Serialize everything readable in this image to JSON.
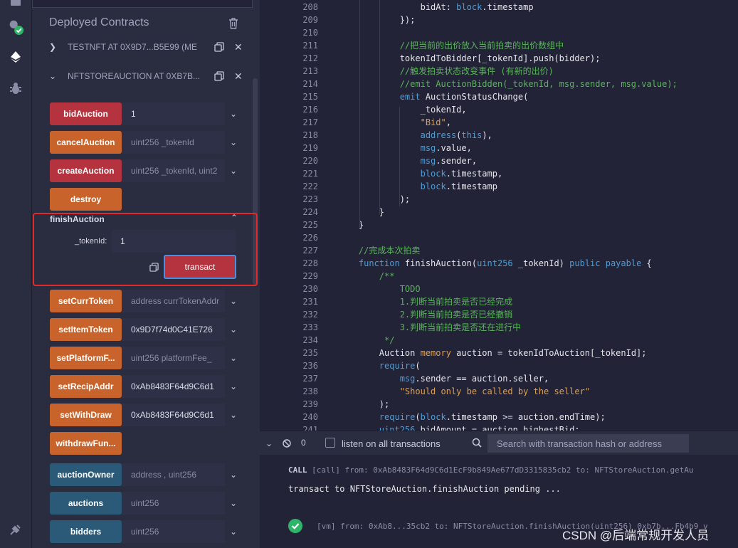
{
  "sidebar_panel": {
    "title": "Deployed Contracts",
    "contracts": [
      {
        "name": "TESTNFT AT 0X9D7...B5E99 (ME",
        "expanded": false
      },
      {
        "name": "NFTSTOREAUCTION AT 0XB7B...",
        "expanded": true
      }
    ],
    "functions": [
      {
        "label": "bidAuction",
        "color": "red",
        "value": "1",
        "placeholder": ""
      },
      {
        "label": "cancelAuction",
        "color": "orange",
        "value": "",
        "placeholder": "uint256 _tokenId"
      },
      {
        "label": "createAuction",
        "color": "red",
        "value": "",
        "placeholder": "uint256 _tokenId, uint2"
      },
      {
        "label": "destroy",
        "color": "orange",
        "value": "",
        "placeholder": ""
      },
      {
        "label": "setCurrToken",
        "color": "orange",
        "value": "",
        "placeholder": "address currTokenAddr"
      },
      {
        "label": "setItemToken",
        "color": "orange",
        "value": "0x9D7f74d0C41E726",
        "placeholder": ""
      },
      {
        "label": "setPlatformF...",
        "color": "orange",
        "value": "",
        "placeholder": "uint256 platformFee_"
      },
      {
        "label": "setRecipAddr",
        "color": "orange",
        "value": "0xAb8483F64d9C6d1",
        "placeholder": ""
      },
      {
        "label": "setWithDraw",
        "color": "orange",
        "value": "0xAb8483F64d9C6d1",
        "placeholder": ""
      },
      {
        "label": "withdrawFun...",
        "color": "orange",
        "value": "",
        "placeholder": ""
      },
      {
        "label": "auctionOwner",
        "color": "blue",
        "value": "",
        "placeholder": "address , uint256"
      },
      {
        "label": "auctions",
        "color": "blue",
        "value": "",
        "placeholder": "uint256"
      },
      {
        "label": "bidders",
        "color": "blue",
        "value": "",
        "placeholder": "uint256"
      }
    ],
    "expanded_function": {
      "title": "finishAuction",
      "param_label": "_tokenId:",
      "param_value": "1",
      "transact_label": "transact"
    }
  },
  "editor": {
    "lines": [
      {
        "n": "208",
        "i": 0,
        "segs": [
          [
            "                bidAt: ",
            ""
          ],
          [
            "block",
            "kw"
          ],
          [
            ".timestamp",
            ""
          ]
        ]
      },
      {
        "n": "209",
        "i": 0,
        "segs": [
          [
            "            });",
            ""
          ]
        ]
      },
      {
        "n": "210",
        "i": 0,
        "segs": [
          [
            "",
            ""
          ]
        ]
      },
      {
        "n": "211",
        "i": 0,
        "segs": [
          [
            "            ",
            ""
          ],
          [
            "//把当前的出价放入当前拍卖的出价数组中",
            "cm"
          ]
        ]
      },
      {
        "n": "212",
        "i": 0,
        "segs": [
          [
            "            tokenIdToBidder[_tokenId].push(bidder);",
            ""
          ]
        ]
      },
      {
        "n": "213",
        "i": 0,
        "segs": [
          [
            "            ",
            ""
          ],
          [
            "//触发拍卖状态改变事件 (有新的出价)",
            "cm"
          ]
        ]
      },
      {
        "n": "214",
        "i": 0,
        "segs": [
          [
            "            ",
            ""
          ],
          [
            "//emit AuctionBidden(_tokenId, msg.sender, msg.value);",
            "cm"
          ]
        ]
      },
      {
        "n": "215",
        "i": 0,
        "segs": [
          [
            "            ",
            ""
          ],
          [
            "emit",
            "kw"
          ],
          [
            " AuctionStatusChange(",
            ""
          ]
        ]
      },
      {
        "n": "216",
        "i": 0,
        "segs": [
          [
            "                _tokenId,",
            ""
          ]
        ]
      },
      {
        "n": "217",
        "i": 0,
        "segs": [
          [
            "                ",
            ""
          ],
          [
            "\"Bid\"",
            "str"
          ],
          [
            ",",
            ""
          ]
        ]
      },
      {
        "n": "218",
        "i": 0,
        "segs": [
          [
            "                ",
            ""
          ],
          [
            "address",
            "kw"
          ],
          [
            "(",
            ""
          ],
          [
            "this",
            "kw"
          ],
          [
            "),",
            ""
          ]
        ]
      },
      {
        "n": "219",
        "i": 0,
        "segs": [
          [
            "                ",
            ""
          ],
          [
            "msg",
            "kw"
          ],
          [
            ".value,",
            ""
          ]
        ]
      },
      {
        "n": "220",
        "i": 0,
        "segs": [
          [
            "                ",
            ""
          ],
          [
            "msg",
            "kw"
          ],
          [
            ".sender,",
            ""
          ]
        ]
      },
      {
        "n": "221",
        "i": 0,
        "segs": [
          [
            "                ",
            ""
          ],
          [
            "block",
            "kw"
          ],
          [
            ".timestamp,",
            ""
          ]
        ]
      },
      {
        "n": "222",
        "i": 0,
        "segs": [
          [
            "                ",
            ""
          ],
          [
            "block",
            "kw"
          ],
          [
            ".timestamp",
            ""
          ]
        ]
      },
      {
        "n": "223",
        "i": 0,
        "segs": [
          [
            "            );",
            ""
          ]
        ]
      },
      {
        "n": "224",
        "i": 0,
        "segs": [
          [
            "        }",
            ""
          ]
        ]
      },
      {
        "n": "225",
        "i": 0,
        "segs": [
          [
            "    }",
            ""
          ]
        ]
      },
      {
        "n": "226",
        "i": 0,
        "segs": [
          [
            "",
            ""
          ]
        ]
      },
      {
        "n": "227",
        "i": 0,
        "segs": [
          [
            "    ",
            ""
          ],
          [
            "//完成本次拍卖",
            "cm"
          ]
        ]
      },
      {
        "n": "228",
        "i": 0,
        "segs": [
          [
            "    ",
            ""
          ],
          [
            "function",
            "kw"
          ],
          [
            " finishAuction(",
            ""
          ],
          [
            "uint256",
            "kw"
          ],
          [
            " _tokenId) ",
            ""
          ],
          [
            "public",
            "kw"
          ],
          [
            " ",
            ""
          ],
          [
            "payable",
            "kw"
          ],
          [
            " {",
            ""
          ]
        ]
      },
      {
        "n": "229",
        "i": 0,
        "segs": [
          [
            "        ",
            ""
          ],
          [
            "/**",
            "cm"
          ]
        ]
      },
      {
        "n": "230",
        "i": 0,
        "segs": [
          [
            "            ",
            ""
          ],
          [
            "TODO",
            "cm"
          ]
        ]
      },
      {
        "n": "231",
        "i": 0,
        "segs": [
          [
            "            ",
            ""
          ],
          [
            "1.判断当前拍卖是否已经完成",
            "cm"
          ]
        ]
      },
      {
        "n": "232",
        "i": 0,
        "segs": [
          [
            "            ",
            ""
          ],
          [
            "2.判断当前拍卖是否已经撤销",
            "cm"
          ]
        ]
      },
      {
        "n": "233",
        "i": 0,
        "segs": [
          [
            "            ",
            ""
          ],
          [
            "3.判断当前拍卖是否还在进行中",
            "cm"
          ]
        ]
      },
      {
        "n": "234",
        "i": 0,
        "segs": [
          [
            "         ",
            ""
          ],
          [
            "*/",
            "cm"
          ]
        ]
      },
      {
        "n": "235",
        "i": 0,
        "segs": [
          [
            "        Auction ",
            ""
          ],
          [
            "memory",
            "str"
          ],
          [
            " auction = tokenIdToAuction[_tokenId];",
            ""
          ]
        ]
      },
      {
        "n": "236",
        "i": 0,
        "segs": [
          [
            "        ",
            ""
          ],
          [
            "require",
            "kw"
          ],
          [
            "(",
            ""
          ]
        ]
      },
      {
        "n": "237",
        "i": 0,
        "segs": [
          [
            "            ",
            ""
          ],
          [
            "msg",
            "kw"
          ],
          [
            ".sender == auction.seller,",
            ""
          ]
        ]
      },
      {
        "n": "238",
        "i": 0,
        "segs": [
          [
            "            ",
            ""
          ],
          [
            "\"Should only be called by the seller\"",
            "str"
          ]
        ]
      },
      {
        "n": "239",
        "i": 0,
        "segs": [
          [
            "        );",
            ""
          ]
        ]
      },
      {
        "n": "240",
        "i": 0,
        "segs": [
          [
            "        ",
            ""
          ],
          [
            "require",
            "kw"
          ],
          [
            "(",
            ""
          ],
          [
            "block",
            "kw"
          ],
          [
            ".timestamp >= auction.endTime);",
            ""
          ]
        ]
      },
      {
        "n": "241",
        "i": 0,
        "segs": [
          [
            "        ",
            ""
          ],
          [
            "uint256",
            "kw"
          ],
          [
            " bidAmount = auction.highestBid;",
            ""
          ]
        ]
      }
    ]
  },
  "terminal": {
    "pending_count": "0",
    "listen_label": "listen on all transactions",
    "search_placeholder": "Search with transaction hash or address",
    "call_tag": "CALL",
    "call_line": "[call] from: 0xAb8483F64d9C6d1EcF9b849Ae677dD3315835cb2 to: NFTStoreAuction.getAu",
    "pending_line": "transact to NFTStoreAuction.finishAuction pending ...",
    "vm_line": "[vm] from: 0xAb8...35cb2 to: NFTStoreAuction.finishAuction(uint256) 0xb7b...Fb4b9 v"
  },
  "watermark": "CSDN @后端常规开发人员",
  "colors": {
    "red": "#b5333f",
    "orange": "#c8642b",
    "blue": "#2b5a78",
    "highlight": "#e32a2a"
  }
}
